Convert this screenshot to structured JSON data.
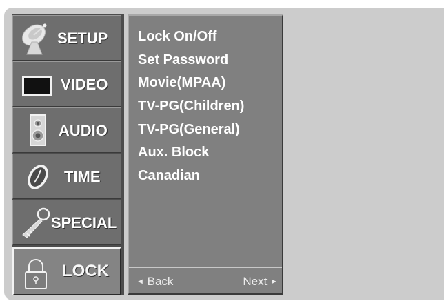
{
  "categories": [
    {
      "id": "setup",
      "label": "SETUP",
      "icon": "satellite-dish-icon",
      "selected": false
    },
    {
      "id": "video",
      "label": "VIDEO",
      "icon": "tv-screen-icon",
      "selected": false
    },
    {
      "id": "audio",
      "label": "AUDIO",
      "icon": "speaker-icon",
      "selected": false
    },
    {
      "id": "time",
      "label": "TIME",
      "icon": "clock-icon",
      "selected": false
    },
    {
      "id": "special",
      "label": "SPECIAL",
      "icon": "key-icon",
      "selected": false
    },
    {
      "id": "lock",
      "label": "LOCK",
      "icon": "padlock-icon",
      "selected": true
    }
  ],
  "lock_menu": {
    "items": [
      "Lock On/Off",
      "Set Password",
      "Movie(MPAA)",
      "TV-PG(Children)",
      "TV-PG(General)",
      "Aux. Block",
      "Canadian"
    ]
  },
  "navigation": {
    "back_label": "Back",
    "next_label": "Next",
    "back_glyph": "◄",
    "next_glyph": "►"
  },
  "colors": {
    "panel_background": "#cccccc",
    "menu_panel": "#808080",
    "text": "#ffffff"
  }
}
